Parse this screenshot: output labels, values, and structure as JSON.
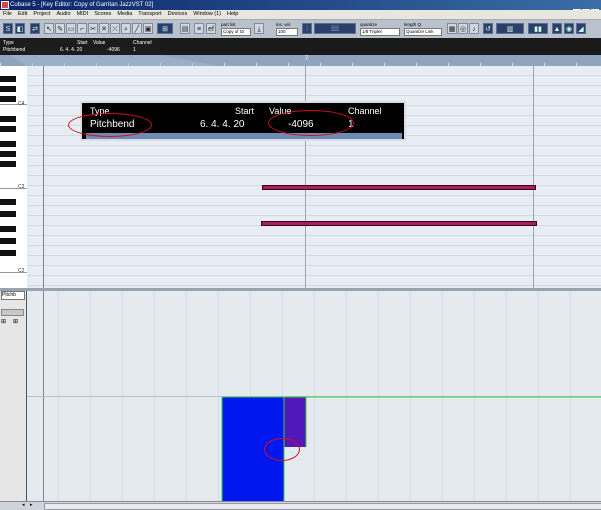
{
  "window": {
    "title": "Cubase 5 - [Key Editor: Copy of Garritan JazzVST 02]",
    "buttons": [
      "_",
      "□",
      "×"
    ]
  },
  "menu": [
    "File",
    "Edit",
    "Project",
    "Audio",
    "MIDI",
    "Scores",
    "Media",
    "Transport",
    "Devices",
    "Window (1)",
    "Help"
  ],
  "toolbar": {
    "part_list_label": "part list",
    "part_list_value": "Copy of Gr",
    "ins_vel_label": "ins. vel.",
    "ins_vel_value": "100",
    "quantize_label": "quantize",
    "quantize_value": "1/8 Triplet",
    "length_label": "length Q",
    "length_value": "Quantize Link"
  },
  "infoline": {
    "headers": [
      "Type",
      "Start",
      "Value",
      "Channel"
    ],
    "values": [
      "Pitchbend",
      "6. 4. 4. 20",
      "-4096",
      "1"
    ]
  },
  "ruler": {
    "marker": "7"
  },
  "keyboard": {
    "labels": [
      "C4",
      "C3",
      "C2"
    ]
  },
  "controller": {
    "lane_label": "Pitchb"
  },
  "colors": {
    "note": "#a0206a",
    "pitchbend": "#0018f0",
    "pitchbend_selected": "#5018b8",
    "highlight": "#d0101a",
    "line": "#3bd13b"
  }
}
